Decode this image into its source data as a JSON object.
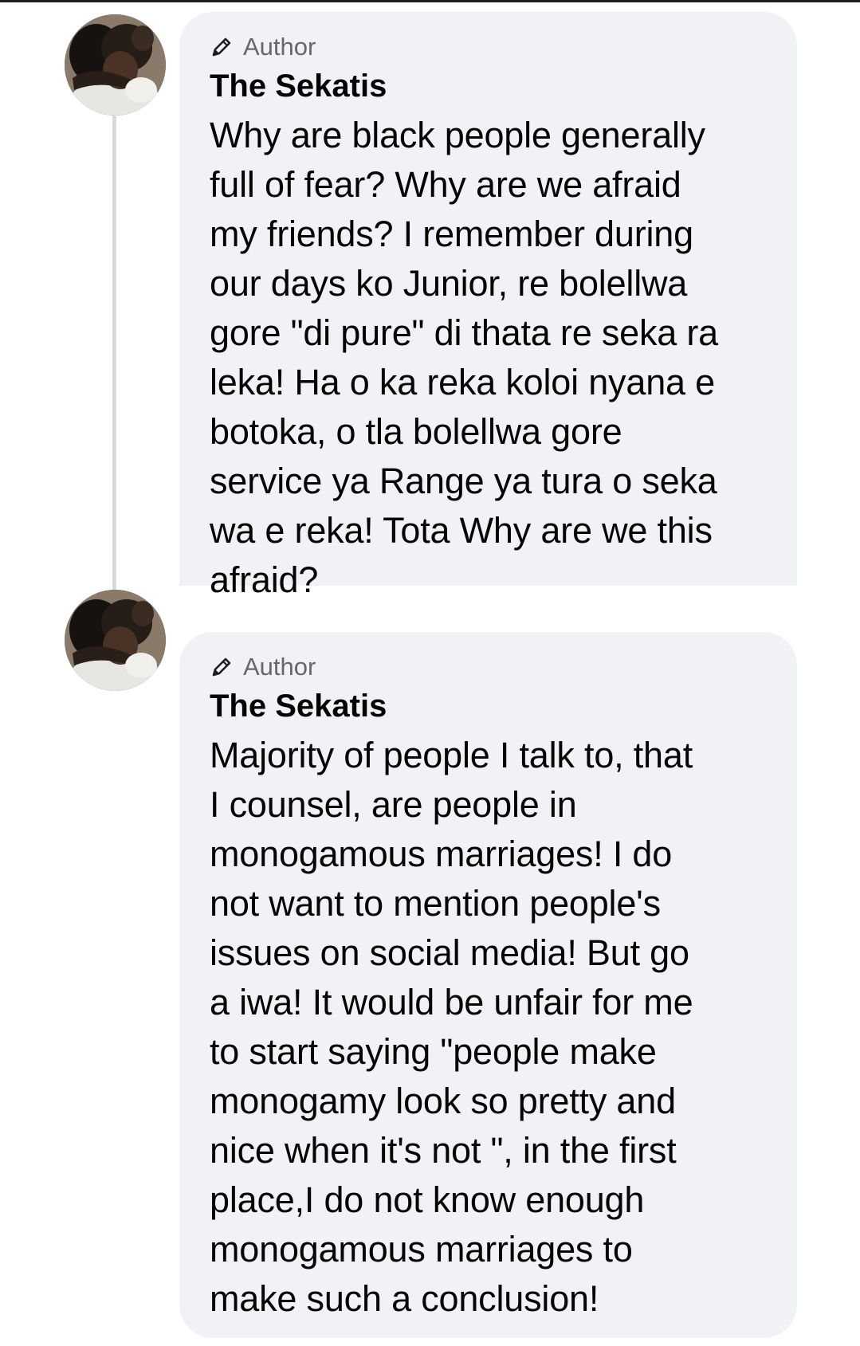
{
  "comments": [
    {
      "badge": "Author",
      "author": "The Sekatis",
      "text": "Why are black people generally\nfull of fear? Why are we afraid\nmy friends? I remember during\nour days ko Junior, re bolellwa\ngore \"di pure\" di thata re seka ra\nleka! Ha o ka reka koloi nyana e\nbotoka, o tla bolellwa gore\nservice ya Range ya tura o seka\nwa e reka! Tota Why are we this\nafraid?"
    },
    {
      "badge": "Author",
      "author": "The Sekatis",
      "text": "Majority of people I talk to, that\nI counsel, are people in\nmonogamous marriages! I do\nnot want to mention people's\nissues on social media! But go\na iwa! It would be unfair for me\nto start saying \"people make\nmonogamy look so pretty and\nnice when it's not \", in the first\nplace,I do not know enough\nmonogamous marriages to\nmake such a conclusion!"
    }
  ],
  "icons": {
    "badge_icon": "pencil-icon",
    "avatar": "avatar-photo"
  },
  "colors": {
    "bubble": "#f0f2f5",
    "thread_line": "#d7d9dd",
    "badge_text": "#65676b",
    "text": "#050505"
  }
}
